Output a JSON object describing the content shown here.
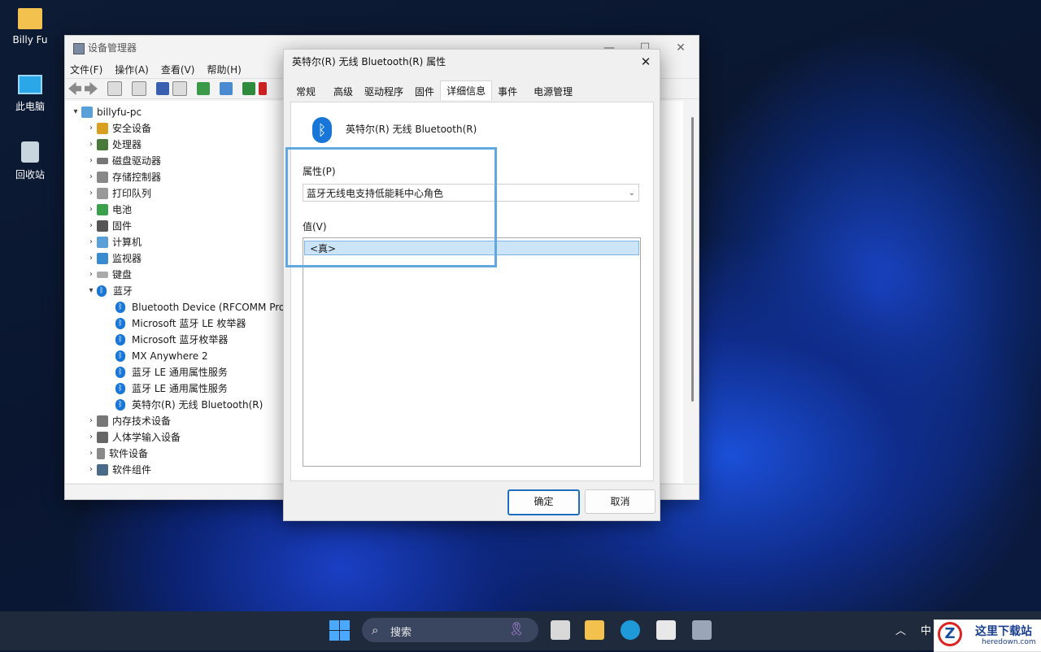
{
  "desktop": {
    "icons": [
      {
        "label": "Billy Fu"
      },
      {
        "label": "此电脑"
      },
      {
        "label": "回收站"
      }
    ]
  },
  "devmgr": {
    "title": "设备管理器",
    "menu": [
      "文件(F)",
      "操作(A)",
      "查看(V)",
      "帮助(H)"
    ],
    "root": "billyfu-pc",
    "categories": [
      "安全设备",
      "处理器",
      "磁盘驱动器",
      "存储控制器",
      "打印队列",
      "电池",
      "固件",
      "计算机",
      "监视器",
      "键盘",
      "蓝牙"
    ],
    "bluetooth_children": [
      "Bluetooth Device (RFCOMM Pro",
      "Microsoft 蓝牙 LE 枚举器",
      "Microsoft 蓝牙枚举器",
      "MX Anywhere 2",
      "蓝牙 LE 通用属性服务",
      "蓝牙 LE 通用属性服务",
      "英特尔(R) 无线 Bluetooth(R)"
    ],
    "categories_after": [
      "内存技术设备",
      "人体学输入设备",
      "软件设备",
      "软件组件"
    ]
  },
  "dialog": {
    "title": "英特尔(R) 无线 Bluetooth(R) 属性",
    "tabs": [
      "常规",
      "高级",
      "驱动程序",
      "固件",
      "详细信息",
      "事件",
      "电源管理"
    ],
    "active_tab": "详细信息",
    "device_name": "英特尔(R) 无线 Bluetooth(R)",
    "property_label": "属性(P)",
    "property_value": "蓝牙无线电支持低能耗中心角色",
    "value_label": "值(V)",
    "value_selected": "<真>",
    "ok": "确定",
    "cancel": "取消"
  },
  "taskbar": {
    "search": "搜索",
    "ime": "中",
    "watermark_title": "这里下载站",
    "watermark_url": "heredown.com"
  },
  "colors": {
    "accent": "#1876d8",
    "highlight": "#5fa8e0",
    "selection": "#cce4f7"
  }
}
